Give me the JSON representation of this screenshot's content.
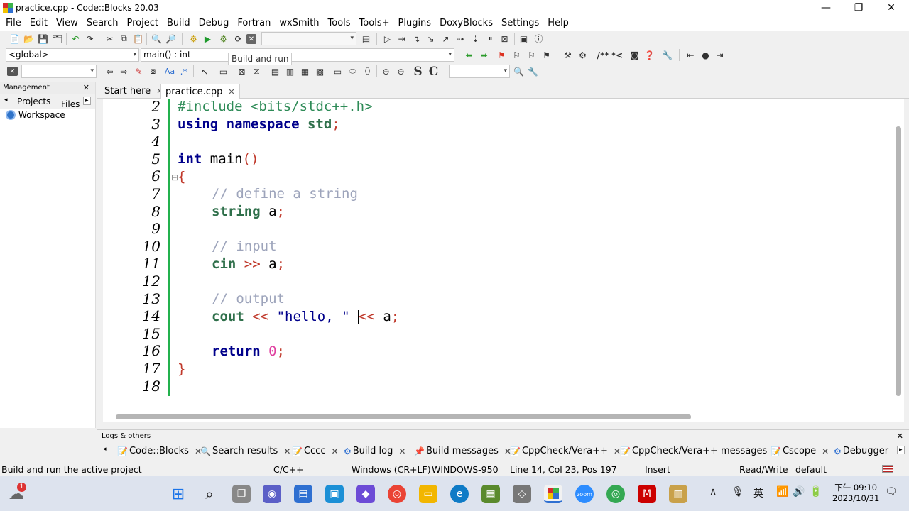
{
  "window": {
    "title": "practice.cpp - Code::Blocks 20.03",
    "minimize": "—",
    "maximize": "❐",
    "close": "✕"
  },
  "menu": [
    "File",
    "Edit",
    "View",
    "Search",
    "Project",
    "Build",
    "Debug",
    "Fortran",
    "wxSmith",
    "Tools",
    "Tools+",
    "Plugins",
    "DoxyBlocks",
    "Settings",
    "Help"
  ],
  "toolbar": {
    "scope_combo": "<global>",
    "function_combo": "main() : int",
    "tooltip": "Build and run",
    "doxy_comment": "/**",
    "doxy_line": "*<",
    "search_style_s": "S",
    "search_style_c": "C"
  },
  "management": {
    "title": "Management",
    "close": "✕",
    "tabs": [
      "Projects",
      "Files"
    ],
    "workspace": "Workspace"
  },
  "editor_tabs": [
    {
      "label": "Start here",
      "close": "✕"
    },
    {
      "label": "practice.cpp",
      "close": "✕"
    }
  ],
  "code": {
    "line_numbers": [
      "2",
      "3",
      "4",
      "5",
      "6",
      "7",
      "8",
      "9",
      "10",
      "11",
      "12",
      "13",
      "14",
      "15",
      "16",
      "17",
      "18"
    ],
    "l2": "#include <bits/stdc++.h>",
    "l3_kw": "using namespace",
    "l3_id": "std",
    "l5_kw": "int",
    "l5_fn": "main",
    "l6": "{",
    "l7": "// define a string",
    "l8_kw": "string",
    "l8_id": "a",
    "l10": "// input",
    "l11_kw": "cin",
    "l11_op": ">>",
    "l11_id": "a",
    "l13": "// output",
    "l14_kw": "cout",
    "l14_op1": "<<",
    "l14_str": "\"hello, \"",
    "l14_op2": "<<",
    "l14_id": "a",
    "l16_kw": "return",
    "l16_num": "0",
    "l17": "}",
    "fold_marker": "⊟"
  },
  "logs": {
    "title": "Logs & others",
    "close": "✕",
    "tabs": [
      "Code::Blocks",
      "Search results",
      "Cccc",
      "Build log",
      "Build messages",
      "CppCheck/Vera++",
      "CppCheck/Vera++ messages",
      "Cscope",
      "Debugger"
    ]
  },
  "status": {
    "message": "Build and run the active project",
    "language": "C/C++",
    "line_endings": "Windows (CR+LF)",
    "encoding": "WINDOWS-950",
    "position": "Line 14, Col 23, Pos 197",
    "mode": "Insert",
    "access": "Read/Write",
    "profile": "default"
  },
  "taskbar": {
    "weather_badge": "1",
    "ime": "英",
    "clock_time": "下午 09:10",
    "clock_date": "2023/10/31",
    "zoom_label": "zoom"
  }
}
